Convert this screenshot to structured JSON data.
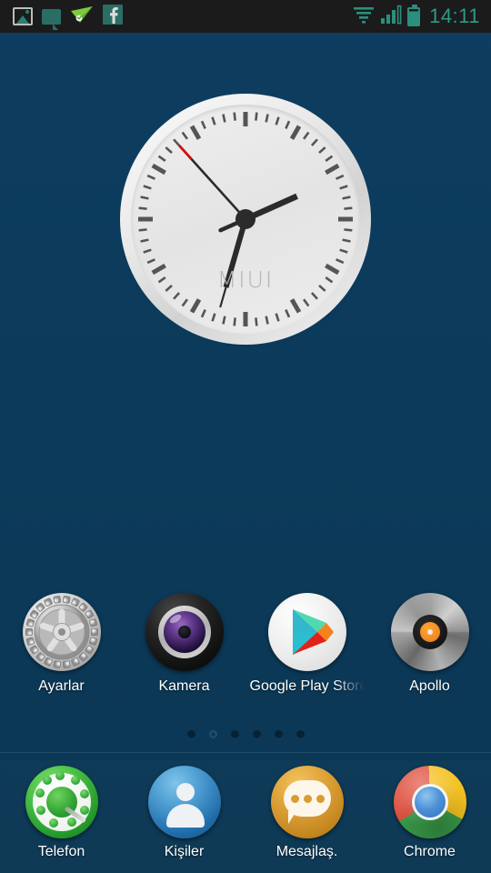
{
  "statusbar": {
    "time": "14:11",
    "left_icons": [
      {
        "name": "gallery-icon",
        "label": "Gallery"
      },
      {
        "name": "message-bubble-icon",
        "label": "Messages"
      },
      {
        "name": "paper-plane-icon",
        "label": "Paper Plane"
      },
      {
        "name": "facebook-icon",
        "label": "f"
      }
    ],
    "right_icons": [
      {
        "name": "wifi-icon",
        "label": "Wi-Fi"
      },
      {
        "name": "cellular-signal-icon",
        "label": "Signal",
        "bars_filled": 3,
        "bars_total": 4
      },
      {
        "name": "battery-icon",
        "label": "Battery"
      }
    ],
    "colors": {
      "background": "#1b1b1b",
      "accent": "#2f9a86"
    }
  },
  "wallpaper": {
    "color_top": "#0d3d60",
    "color_bottom": "#0b3754"
  },
  "clock_widget": {
    "brand": "MIUI",
    "hour_angle_deg": 66,
    "minute_angle_deg": 196,
    "second_angle_deg": 318,
    "hands": {
      "hour": "hour-hand",
      "minute": "minute-hand",
      "second": "second-hand"
    },
    "colors": {
      "face": "#ececec",
      "bezel": "#e3e3e3",
      "tick": "#555555",
      "hand": "#2b2b2b",
      "second_tip": "#cc1111",
      "brand_text": "#b4b4b4"
    }
  },
  "app_row": {
    "apps": [
      {
        "label": "Ayarlar",
        "icon": "settings-gear-icon",
        "truncated": false
      },
      {
        "label": "Kamera",
        "icon": "camera-lens-icon",
        "truncated": false
      },
      {
        "label": "Google Play Store",
        "icon": "google-play-icon",
        "truncated": true
      },
      {
        "label": "Apollo",
        "icon": "vinyl-record-icon",
        "truncated": false
      }
    ]
  },
  "page_indicator": {
    "total": 6,
    "active_index": 1
  },
  "dock": {
    "apps": [
      {
        "label": "Telefon",
        "icon": "phone-dialer-icon"
      },
      {
        "label": "Kişiler",
        "icon": "contacts-person-icon"
      },
      {
        "label": "Mesajlaş.",
        "icon": "messaging-bubble-icon"
      },
      {
        "label": "Chrome",
        "icon": "chrome-icon"
      }
    ]
  }
}
